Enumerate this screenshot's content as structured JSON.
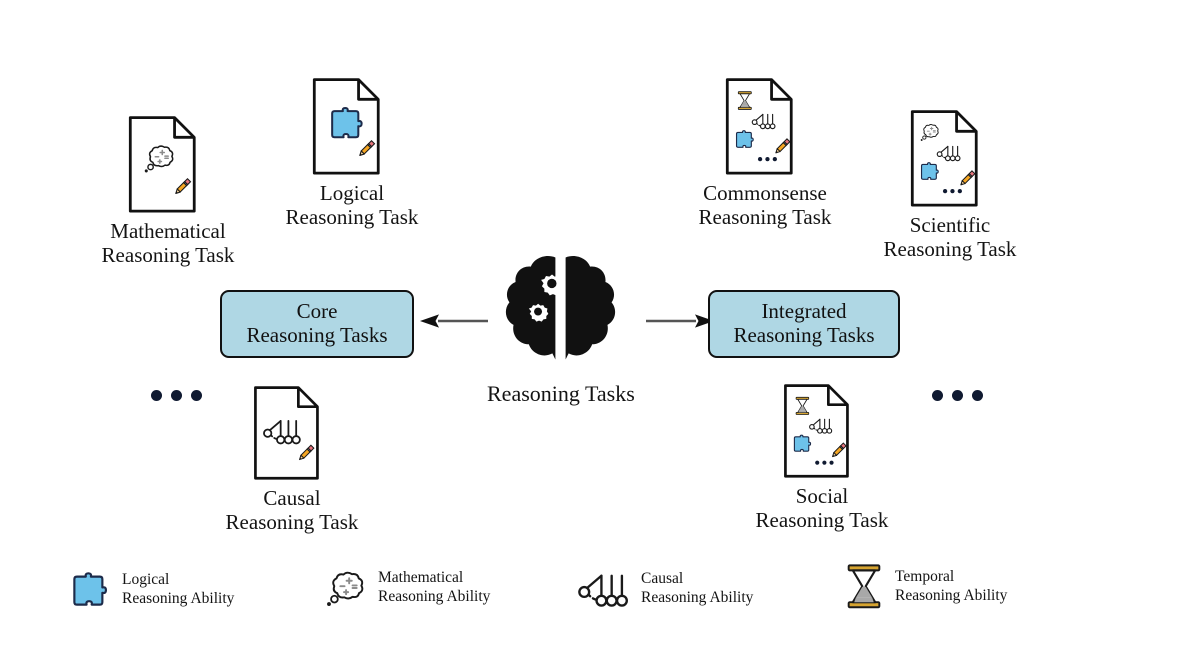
{
  "diagram": {
    "center": {
      "icon": "brain-gears-icon",
      "label": "Reasoning Tasks"
    },
    "categories": [
      {
        "id": "core",
        "label": "Core\nReasoning Tasks",
        "fill": "#AFD7E4",
        "side": "left"
      },
      {
        "id": "integrated",
        "label": "Integrated\nReasoning Tasks",
        "fill": "#AFD7E4",
        "side": "right"
      }
    ],
    "arrows": [
      {
        "id": "arrow-to-core",
        "direction": "left"
      },
      {
        "id": "arrow-to-integrated",
        "direction": "right"
      }
    ],
    "tasks": [
      {
        "id": "mathematical",
        "label": "Mathematical\nReasoning Task",
        "icon": "document-math-pencil-icon",
        "group": "core"
      },
      {
        "id": "logical",
        "label": "Logical\nReasoning Task",
        "icon": "document-puzzle-pencil-icon",
        "group": "core"
      },
      {
        "id": "causal",
        "label": "Causal\nReasoning Task",
        "icon": "document-cradle-pencil-icon",
        "group": "core"
      },
      {
        "id": "commonsense",
        "label": "Commonsense\nReasoning Task",
        "icon": "document-multi-ability-pencil-icon",
        "group": "integrated"
      },
      {
        "id": "scientific",
        "label": "Scientific\nReasoning Task",
        "icon": "document-multi-ability-pencil-icon",
        "group": "integrated"
      },
      {
        "id": "social",
        "label": "Social\nReasoning Task",
        "icon": "document-multi-ability-pencil-icon",
        "group": "integrated"
      }
    ],
    "ellipses": [
      {
        "id": "ellipsis-core",
        "text": "•••"
      },
      {
        "id": "ellipsis-integrated",
        "text": "•••"
      }
    ]
  },
  "legend": {
    "items": [
      {
        "id": "logical-ability",
        "icon": "puzzle-icon",
        "label": "Logical\nReasoning Ability"
      },
      {
        "id": "mathematical-ability",
        "icon": "thought-math-icon",
        "label": "Mathematical\nReasoning Ability"
      },
      {
        "id": "causal-ability",
        "icon": "newtons-cradle-icon",
        "label": "Causal\nReasoning Ability"
      },
      {
        "id": "temporal-ability",
        "icon": "hourglass-icon",
        "label": "Temporal\nReasoning Ability"
      }
    ]
  },
  "colors": {
    "box_fill": "#AFD7E4",
    "puzzle_blue": "#6DC2EA",
    "puzzle_outline": "#1d2b4a",
    "pencil_body": "#F5A623",
    "pencil_eraser": "#E8747C",
    "hourglass_cap": "#C8951E",
    "hourglass_sand": "#A8A8A8",
    "dot_navy": "#101a31",
    "arrow_line": "#555555",
    "text": "#141414"
  }
}
